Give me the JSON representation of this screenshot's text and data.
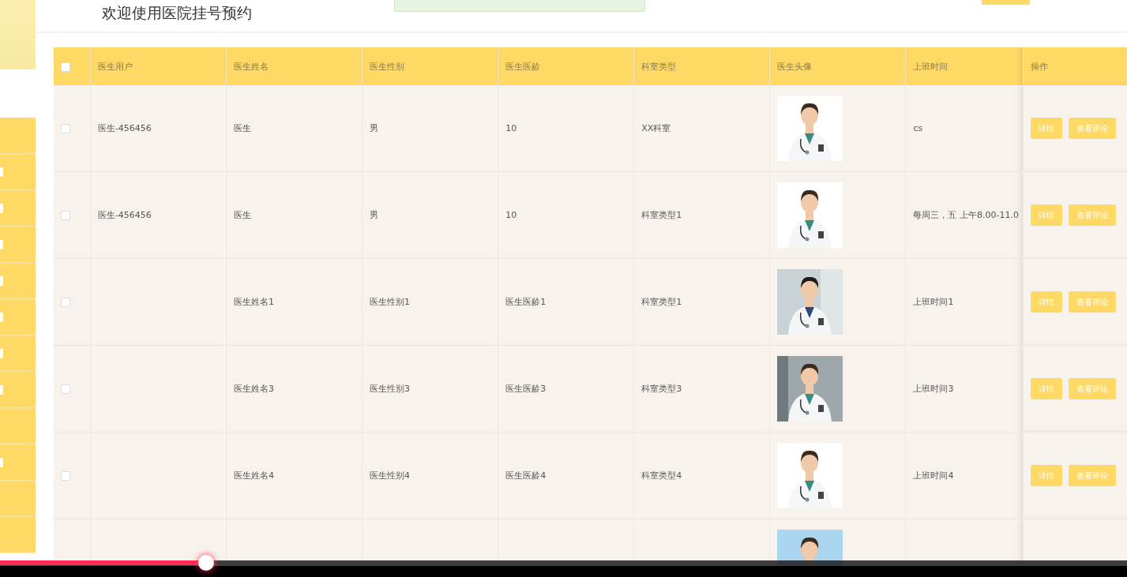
{
  "header": {
    "title": "欢迎使用医院挂号预约"
  },
  "sidebar": {
    "items": [
      {
        "kind": "plain"
      },
      {
        "kind": "icon"
      },
      {
        "kind": "icon"
      },
      {
        "kind": "icon"
      },
      {
        "kind": "icon"
      },
      {
        "kind": "icon"
      },
      {
        "kind": "icon"
      },
      {
        "kind": "icon"
      },
      {
        "kind": "plain"
      },
      {
        "kind": "icon"
      },
      {
        "kind": "plain"
      },
      {
        "kind": "plain"
      }
    ]
  },
  "table": {
    "select_all": {
      "checked": false
    },
    "columns": [
      "医生用户",
      "医生姓名",
      "医生性别",
      "医生医龄",
      "科室类型",
      "医生头像",
      "上班时间",
      "操作"
    ],
    "rows": [
      {
        "checked": false,
        "user": "医生-456456",
        "name": "医生",
        "gender": "男",
        "age": "10",
        "department": "XX科室",
        "avatar": {
          "kind": "picture"
        },
        "hours": "cs",
        "actions": [
          "详情",
          "查看评论"
        ]
      },
      {
        "checked": false,
        "user": "医生-456456",
        "name": "医生",
        "gender": "男",
        "age": "10",
        "department": "科室类型1",
        "avatar": {
          "kind": "picture"
        },
        "hours": "每周三，五 上午8.00-11.0",
        "actions": [
          "详情",
          "查看评论"
        ]
      },
      {
        "checked": false,
        "user": "",
        "name": "医生姓名1",
        "gender": "医生性别1",
        "age": "医生医龄1",
        "department": "科室类型1",
        "avatar": {
          "kind": "picture"
        },
        "hours": "上班时间1",
        "actions": [
          "详情",
          "查看评论"
        ]
      },
      {
        "checked": false,
        "user": "",
        "name": "医生姓名3",
        "gender": "医生性别3",
        "age": "医生医龄3",
        "department": "科室类型3",
        "avatar": {
          "kind": "picture"
        },
        "hours": "上班时间3",
        "actions": [
          "详情",
          "查看评论"
        ]
      },
      {
        "checked": false,
        "user": "",
        "name": "医生姓名4",
        "gender": "医生性别4",
        "age": "医生医龄4",
        "department": "科室类型4",
        "avatar": {
          "kind": "picture"
        },
        "hours": "上班时间4",
        "actions": [
          "详情",
          "查看评论"
        ]
      },
      {
        "avatar": {
          "kind": "picture"
        }
      }
    ]
  },
  "video_player": {
    "level": 0.183
  }
}
